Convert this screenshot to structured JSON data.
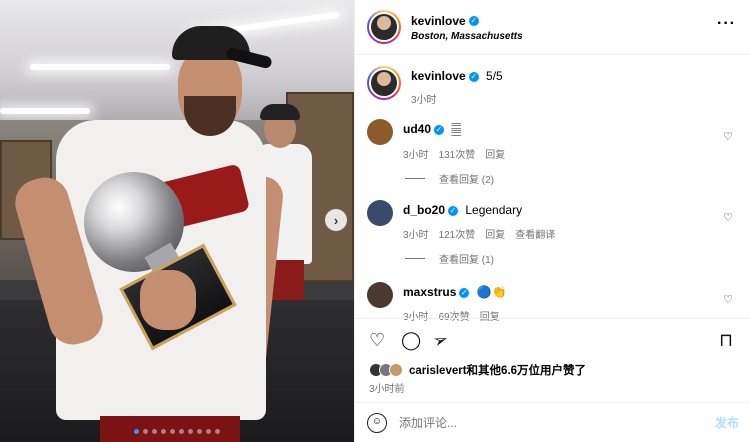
{
  "post": {
    "username": "kevinlove",
    "location": "Boston, Massachusetts",
    "more_icon": "more-horizontal-icon",
    "caption": "5/5",
    "caption_time": "3小时",
    "photo_carousel": {
      "total": 10,
      "active_index": 0
    }
  },
  "comments": [
    {
      "username": "ud40",
      "verified": true,
      "text": "𝄛",
      "time": "3小时",
      "likes": "131次赞",
      "reply": "回复",
      "translate": "",
      "view_replies": "查看回复 (2)"
    },
    {
      "username": "d_bo20",
      "verified": true,
      "text": "Legendary",
      "time": "3小时",
      "likes": "121次赞",
      "reply": "回复",
      "translate": "查看翻译",
      "view_replies": "查看回复 (1)"
    },
    {
      "username": "maxstrus",
      "verified": true,
      "text": "🔵👏",
      "time": "3小时",
      "likes": "69次赞",
      "reply": "回复",
      "translate": "",
      "view_replies": ""
    }
  ],
  "likes": {
    "liked_by": "carislevert",
    "others": "和其他6.6万位用户赞了"
  },
  "posted_time": "3小时前",
  "comment_box": {
    "placeholder": "添加评论...",
    "post_label": "发布"
  },
  "colors": {
    "verified": "#0095f6",
    "dot_active": "#3897f0",
    "post_disabled": "#b2dffc"
  }
}
